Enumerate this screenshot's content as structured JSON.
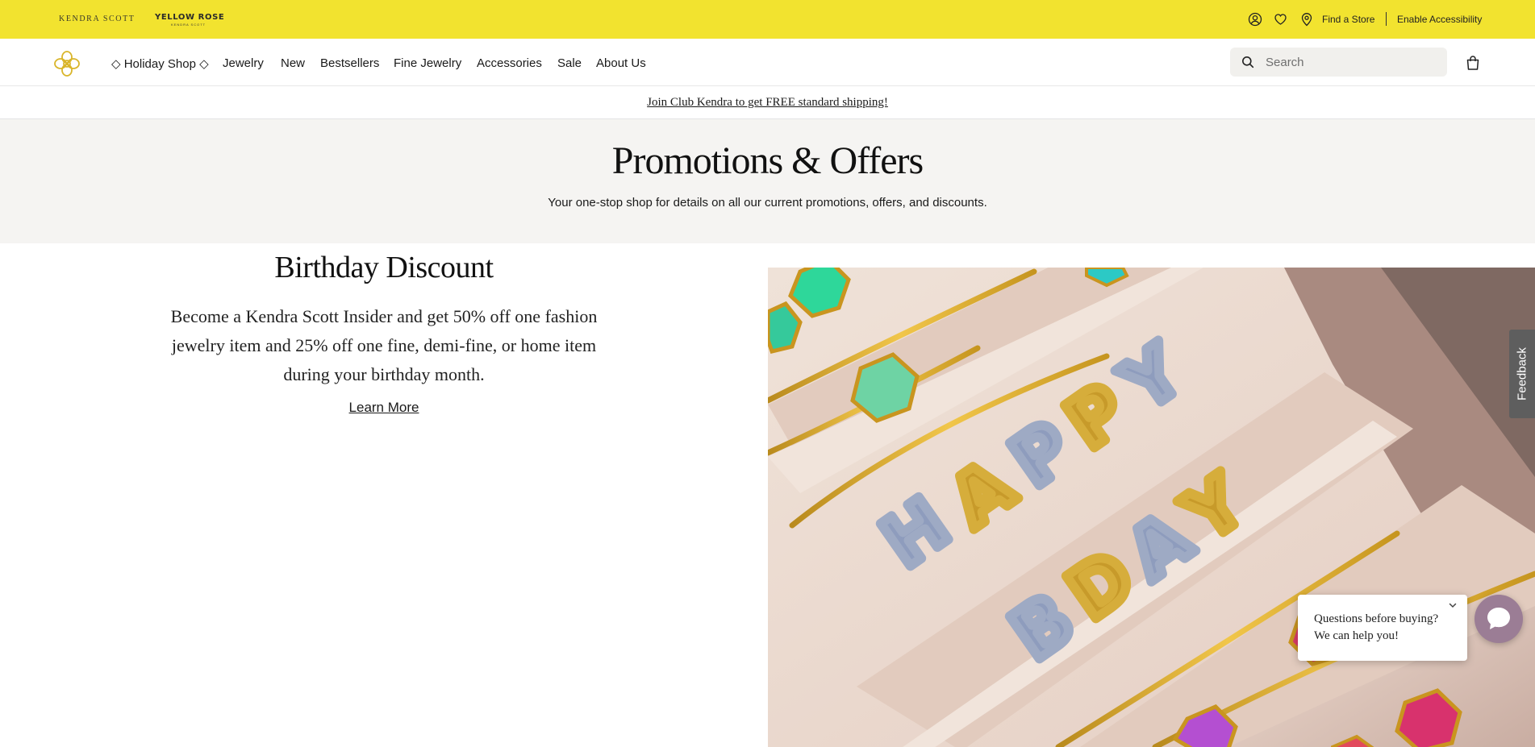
{
  "topbar": {
    "brand_primary": "KENDRA SCOTT",
    "brand_secondary": "YELLOW ROSE",
    "brand_secondary_sub": "KENDRA SCOTT",
    "find_store": "Find a Store",
    "accessibility": "Enable Accessibility",
    "icons": [
      "account-icon",
      "heart-icon",
      "location-pin-icon"
    ],
    "background_color": "#f2e32f"
  },
  "nav": {
    "items": [
      {
        "label": "◇ Holiday Shop ◇"
      },
      {
        "label": "Jewelry"
      },
      {
        "label": "New"
      },
      {
        "label": "Bestsellers"
      },
      {
        "label": "Fine Jewelry"
      },
      {
        "label": "Accessories"
      },
      {
        "label": "Sale"
      },
      {
        "label": "About Us"
      }
    ],
    "search_placeholder": "Search"
  },
  "promo": {
    "text": "Join Club Kendra to get FREE standard shipping!"
  },
  "hero": {
    "title": "Promotions & Offers",
    "subtitle": "Your one-stop shop for details on all our current promotions, offers, and discounts."
  },
  "offer": {
    "title": "Birthday Discount",
    "description": "Become a Kendra Scott Insider and get 50% off one fashion jewelry item and 25% off one fine, demi-fine, or home item during your birthday month.",
    "link": "Learn More",
    "image_text": [
      "HAPPY",
      "BDAY"
    ]
  },
  "feedback": {
    "label": "Feedback"
  },
  "chat": {
    "line1": "Questions before buying?",
    "line2": "We can help you!",
    "launcher_color": "#9b7d95"
  }
}
